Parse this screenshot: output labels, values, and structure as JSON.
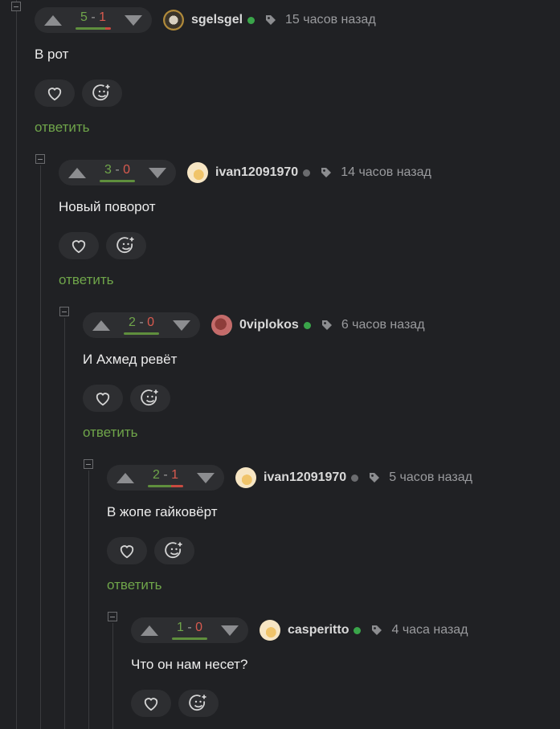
{
  "comments": [
    {
      "score_plus": "5",
      "score_minus": "1",
      "plus_fraction": 0.83,
      "username": "sgelsgel",
      "online": true,
      "time": "15 часов назад",
      "text": "В рот",
      "reply_label": "ответить"
    },
    {
      "score_plus": "3",
      "score_minus": "0",
      "plus_fraction": 1.0,
      "username": "ivan12091970",
      "online": false,
      "time": "14 часов назад",
      "text": "Новый поворот",
      "reply_label": "ответить"
    },
    {
      "score_plus": "2",
      "score_minus": "0",
      "plus_fraction": 1.0,
      "username": "0viplokos",
      "online": true,
      "time": "6 часов назад",
      "text": "И Ахмед ревёт",
      "reply_label": "ответить"
    },
    {
      "score_plus": "2",
      "score_minus": "1",
      "plus_fraction": 0.67,
      "username": "ivan12091970",
      "online": false,
      "time": "5 часов назад",
      "text": "В жопе гайковёрт",
      "reply_label": "ответить"
    },
    {
      "score_plus": "1",
      "score_minus": "0",
      "plus_fraction": 1.0,
      "username": "casperitto",
      "online": true,
      "time": "4 часа назад",
      "text": "Что он нам несет?",
      "reply_label": ""
    }
  ],
  "icons": {
    "upvote": "arrow-up-icon",
    "downvote": "arrow-down-icon",
    "tag": "tag-icon",
    "like": "heart-icon",
    "reaction": "emoji-add-icon",
    "collapse": "collapse-icon"
  },
  "colors": {
    "positive": "#6fa54a",
    "negative": "#d85a4f",
    "online": "#3aa54a",
    "offline": "#6b6c6f"
  }
}
